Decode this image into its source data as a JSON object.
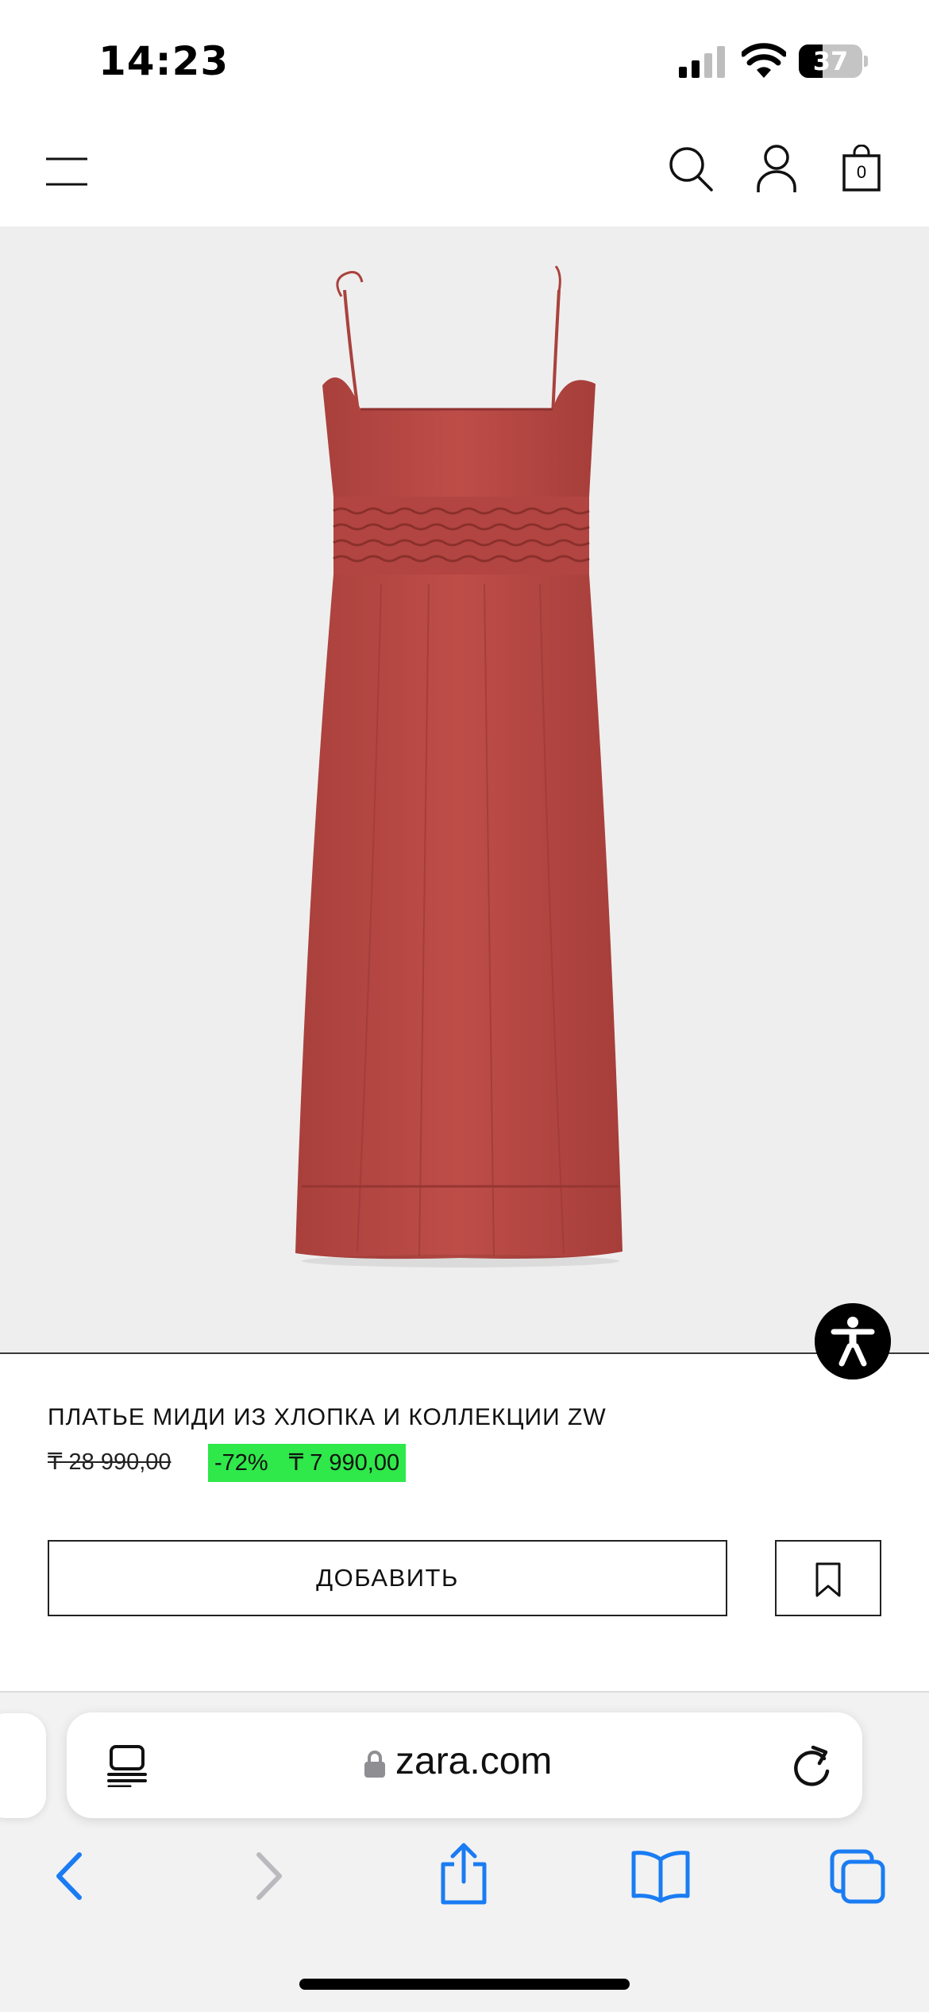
{
  "status_bar": {
    "time": "14:23",
    "battery_level": "37",
    "battery_fraction": 0.37
  },
  "header": {
    "bag_count": "0",
    "icons": [
      "menu-icon",
      "search-icon",
      "account-icon",
      "shopping-bag-icon"
    ]
  },
  "product": {
    "title": "ПЛАТЬЕ МИДИ ИЗ ХЛОПКА И КОЛЛЕКЦИИ ZW",
    "old_price": "₸ 28 990,00",
    "discount": "-72%",
    "new_price": "₸ 7 990,00",
    "add_label": "ДОБАВИТЬ",
    "dress_color": "#b94a45",
    "sale_color": "#2fe84a"
  },
  "browser": {
    "url": "zara.com",
    "accent": "#1a7cf3",
    "icons": [
      "reader-icon",
      "lock-icon",
      "reload-icon",
      "back-icon",
      "forward-icon",
      "share-icon",
      "bookmarks-icon",
      "tabs-icon"
    ]
  }
}
